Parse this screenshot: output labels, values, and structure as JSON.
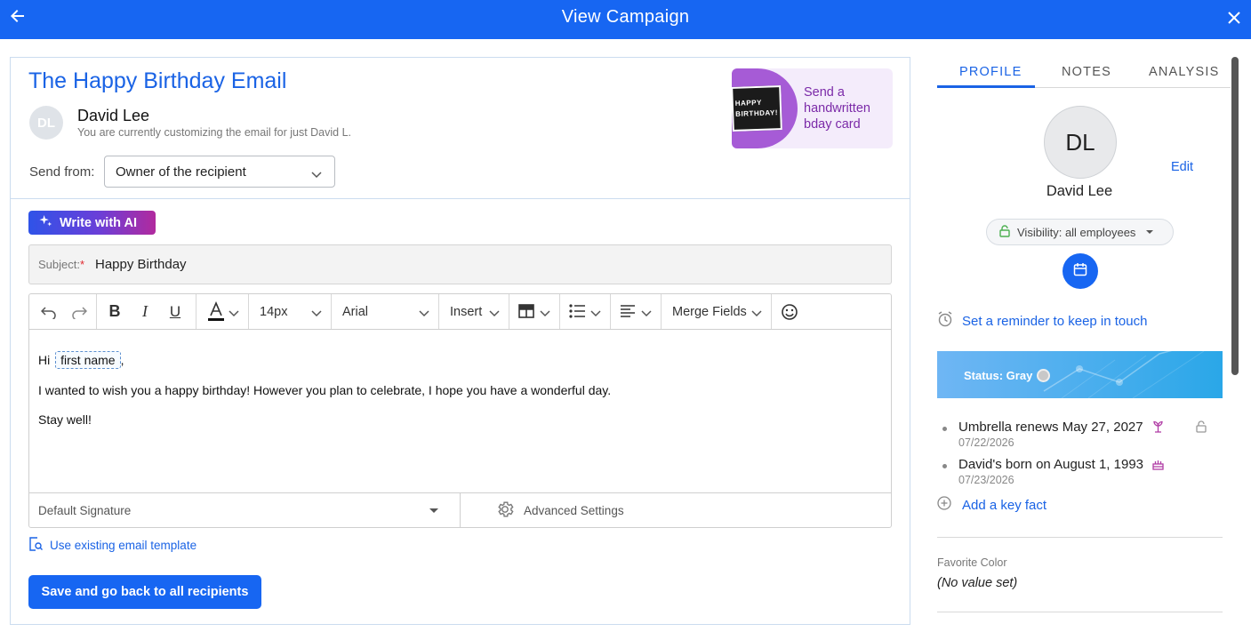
{
  "header": {
    "title": "View Campaign"
  },
  "email": {
    "title": "The Happy Birthday Email",
    "recipient_initials": "DL",
    "recipient_name": "David Lee",
    "recipient_note": "You are currently customizing the email for just David L.",
    "send_from_label": "Send from:",
    "send_from_value": "Owner of the recipient",
    "promo_text": "Send a handwritten bday card",
    "promo_card_text": "HAPPY BIRTHDAY!",
    "ai_button": "Write with AI",
    "subject_label": "Subject:",
    "subject_required": "*",
    "subject_value": "Happy Birthday",
    "toolbar": {
      "font_size": "14px",
      "font_family": "Arial",
      "insert_label": "Insert",
      "merge_fields_label": "Merge Fields"
    },
    "body": {
      "greeting": "Hi",
      "merge_field": "first name",
      "greeting_end": ",",
      "line2": "I wanted to wish you a happy birthday! However you plan to celebrate, I hope you have a wonderful day.",
      "line3": "Stay well!"
    },
    "signature_value": "Default Signature",
    "advanced_settings": "Advanced Settings",
    "template_link": "Use existing email template",
    "save_button": "Save and go back to all recipients"
  },
  "profile": {
    "tabs": [
      "PROFILE",
      "NOTES",
      "ANALYSIS"
    ],
    "active_tab": "PROFILE",
    "initials": "DL",
    "edit_label": "Edit",
    "name": "David Lee",
    "visibility": "Visibility: all employees",
    "reminder": "Set a reminder to keep in touch",
    "status": "Status: Gray",
    "key_facts": [
      {
        "text": "Umbrella renews May 27, 2027",
        "date": "07/22/2026",
        "icon": "umbrella-plant-icon"
      },
      {
        "text": "David's born on August 1, 1993",
        "date": "07/23/2026",
        "icon": "cake-icon"
      }
    ],
    "add_fact": "Add a key fact",
    "favorite_color_label": "Favorite Color",
    "favorite_color_value": "(No value set)"
  },
  "colors": {
    "brand_blue": "#1766f2",
    "link_blue": "#1a63e5",
    "promo_purple": "#a65bd6"
  }
}
